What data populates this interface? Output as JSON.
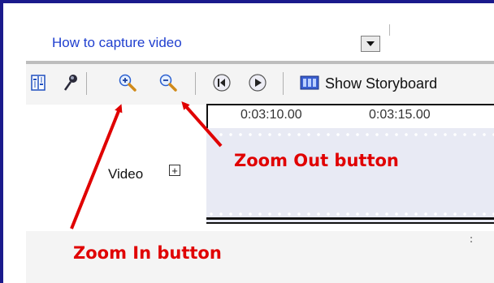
{
  "header": {
    "task_link": "How to capture video"
  },
  "toolbar": {
    "storyboard_label": "Show Storyboard"
  },
  "timeline": {
    "ruler_ticks": [
      "0:03:10.00",
      "0:03:15.00"
    ],
    "track_label": "Video",
    "expand_symbol": "+"
  },
  "annotations": {
    "zoom_out": "Zoom Out button",
    "zoom_in": "Zoom In button"
  },
  "colors": {
    "frame": "#1a1a8c",
    "link": "#1f3fcf",
    "annotation": "#e00000",
    "track": "#e8eaf4"
  },
  "icons": [
    "set-audio-levels-icon",
    "narrate-timeline-icon",
    "zoom-in-icon",
    "zoom-out-icon",
    "rewind-icon",
    "play-icon",
    "storyboard-icon",
    "dropdown-arrow-icon"
  ]
}
